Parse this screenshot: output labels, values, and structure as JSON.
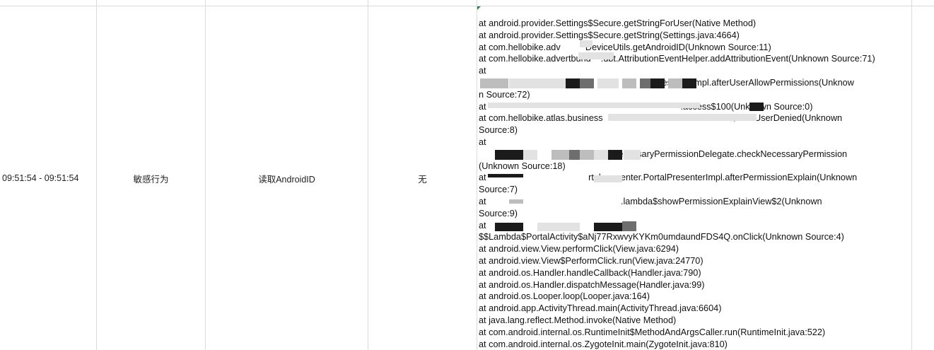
{
  "row": {
    "time": "09:51:54 - 09:51:54",
    "category": "敏感行为",
    "behavior": "读取AndroidID",
    "extra": "无"
  },
  "stack_lines": [
    "at android.provider.Settings$Secure.getStringForUser(Native Method)",
    "at android.provider.Settings$Secure.getString(Settings.java:4664)",
    "at com.hellobike.adv          DeviceUtils.getAndroidID(Unknown Source:11)",
    "at com.hellobike.advertbund    .ubt.AttributionEventHelper.addAttributionEvent(Unknown Source:71)",
    "at",
    "                                                                      PresenterImpl.afterUserAllowPermissions(Unknow",
    "n Source:72)",
    "at                                                                              .access$100(Unknown Source:0)",
    "at com.hellobike.atlas.business                                                   l$1.onUserDenied(Unknown",
    "Source:8)",
    "at",
    "                                              .AppNecessaryPermissionDelegate.checkNecessaryPermission",
    "(Unknown Source:18)",
    "at                                         rtal.presenter.PortalPresenterImpl.afterPermissionExplain(Unknown",
    "Source:7)",
    "at                                                      .lambda$showPermissionExplainView$2(Unknown",
    "Source:9)",
    "at                                                         -",
    "$$Lambda$PortalActivity$aNj77RxwvyKYKm0umdaundFDS4Q.onClick(Unknown Source:4)",
    "at android.view.View.performClick(View.java:6294)",
    "at android.view.View$PerformClick.run(View.java:24770)",
    "at android.os.Handler.handleCallback(Handler.java:790)",
    "at android.os.Handler.dispatchMessage(Handler.java:99)",
    "at android.os.Looper.loop(Looper.java:164)",
    "at android.app.ActivityThread.main(ActivityThread.java:6604)",
    "at java.lang.reflect.Method.invoke(Native Method)",
    "at com.android.internal.os.RuntimeInit$MethodAndArgsCaller.run(RuntimeInit.java:522)",
    "at com.android.internal.os.ZygoteInit.main(ZygoteInit.java:810)"
  ],
  "colors": {
    "grid": "#d9dbe0",
    "selection_marker": "#1e8e3e",
    "text": "#111111"
  }
}
